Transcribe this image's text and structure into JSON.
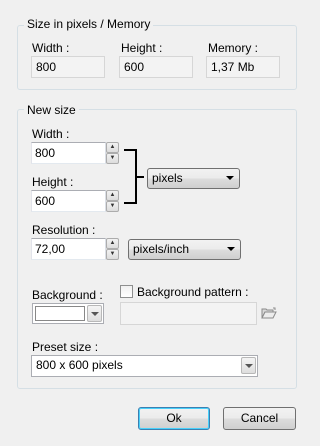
{
  "size_group": {
    "title": "Size in pixels / Memory",
    "width_label": "Width :",
    "height_label": "Height :",
    "memory_label": "Memory :",
    "width_value": "800",
    "height_value": "600",
    "memory_value": "1,37 Mb"
  },
  "new_size": {
    "title": "New size",
    "width_label": "Width :",
    "width_value": "800",
    "height_label": "Height :",
    "height_value": "600",
    "unit_selected": "pixels",
    "resolution_label": "Resolution :",
    "resolution_value": "72,00",
    "resolution_unit_selected": "pixels/inch",
    "background_label": "Background :",
    "background_color": "#ffffff",
    "background_pattern_label": "Background pattern :",
    "background_pattern_checked": false,
    "background_pattern_value": "",
    "preset_label": "Preset size :",
    "preset_selected": "800 x 600 pixels"
  },
  "buttons": {
    "ok": "Ok",
    "cancel": "Cancel"
  }
}
